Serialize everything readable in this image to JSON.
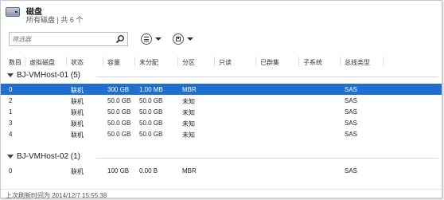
{
  "header": {
    "title": "磁盘",
    "subtitle": "所有磁盘 | 共 6 个",
    "icon": "disk-icon"
  },
  "toolbar": {
    "filter_placeholder": "筛选器",
    "search_icon": "search-icon",
    "view_button_icon": "list-view-icon",
    "save_button_icon": "save-icon"
  },
  "table": {
    "columns": [
      "数目",
      "虚拟磁盘",
      "状态",
      "容量",
      "未分配",
      "分区",
      "只读",
      "已群集",
      "子系统",
      "总线类型"
    ],
    "groups": [
      {
        "label": "BJ-VMHost-01 (5)",
        "rows": [
          [
            "0",
            "",
            "联机",
            "300 GB",
            "1.00 MB",
            "MBR",
            "",
            "",
            "",
            "SAS"
          ],
          [
            "2",
            "",
            "联机",
            "50.0 GB",
            "50.0 GB",
            "未知",
            "",
            "",
            "",
            "SAS"
          ],
          [
            "1",
            "",
            "联机",
            "50.0 GB",
            "50.0 GB",
            "未知",
            "",
            "",
            "",
            "SAS"
          ],
          [
            "3",
            "",
            "联机",
            "50.0 GB",
            "50.0 GB",
            "未知",
            "",
            "",
            "",
            "SAS"
          ],
          [
            "4",
            "",
            "联机",
            "50.0 GB",
            "50.0 GB",
            "未知",
            "",
            "",
            "",
            "SAS"
          ]
        ]
      },
      {
        "label": "BJ-VMHost-02 (1)",
        "rows": [
          [
            "0",
            "",
            "联机",
            "100 GB",
            "0.00 B",
            "MBR",
            "",
            "",
            "",
            "SAS"
          ]
        ]
      }
    ],
    "selected_color": "#1f6fd1"
  },
  "footer": {
    "last_refresh": "上次刷新时间为 2014/12/7 15:55:38"
  }
}
